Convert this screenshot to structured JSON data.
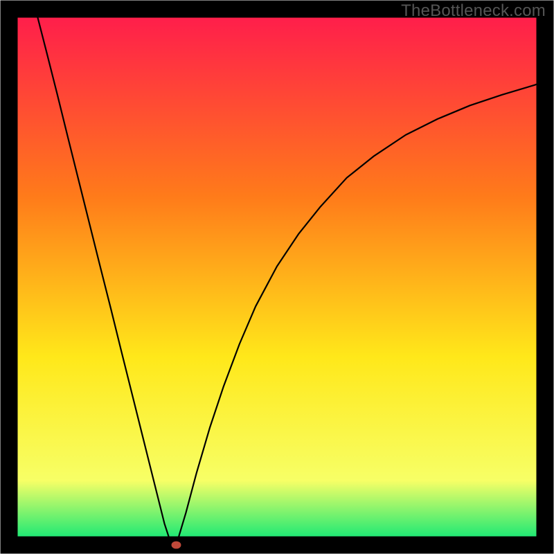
{
  "watermark": "TheBottleneck.com",
  "chart_data": {
    "type": "line",
    "title": "",
    "xlabel": "",
    "ylabel": "",
    "xlim": [
      0,
      100
    ],
    "ylim": [
      0,
      100
    ],
    "grid": false,
    "background_gradient": {
      "top": "#ff1a4d",
      "mid1": "#ff7b1a",
      "mid2": "#ffe81a",
      "low": "#f7ff66",
      "bottom": "#00e676"
    },
    "border_color": "#000000",
    "note": "Values read off the plot by vertical position (0–100). The chart has no visible tick labels; x and y are normalized to the plot area.",
    "series": [
      {
        "name": "left-branch",
        "color": "#000000",
        "x": [
          5.2,
          7.0,
          9.0,
          11.0,
          13.0,
          15.0,
          17.0,
          19.0,
          21.0,
          23.0,
          25.0,
          27.0,
          29.0,
          30.3,
          31.2
        ],
        "y": [
          99.0,
          92.0,
          84.1,
          76.0,
          68.0,
          60.0,
          52.0,
          44.1,
          36.0,
          28.0,
          20.0,
          12.0,
          4.0,
          0.0,
          0.0
        ]
      },
      {
        "name": "right-branch",
        "color": "#000000",
        "x": [
          31.2,
          33.0,
          35.0,
          37.5,
          40.0,
          43.0,
          46.0,
          50.0,
          54.0,
          58.0,
          63.0,
          68.0,
          74.0,
          80.0,
          86.0,
          92.0,
          98.0,
          100.0
        ],
        "y": [
          0.0,
          6.0,
          13.5,
          22.0,
          29.5,
          37.5,
          44.5,
          52.0,
          58.0,
          63.0,
          68.5,
          72.5,
          76.5,
          79.5,
          82.0,
          84.0,
          85.8,
          86.5
        ]
      }
    ],
    "marker": {
      "name": "trough-marker",
      "x": 31.2,
      "y": 0.0,
      "rx": 0.9,
      "ry": 0.7,
      "color": "#c0493a"
    }
  }
}
